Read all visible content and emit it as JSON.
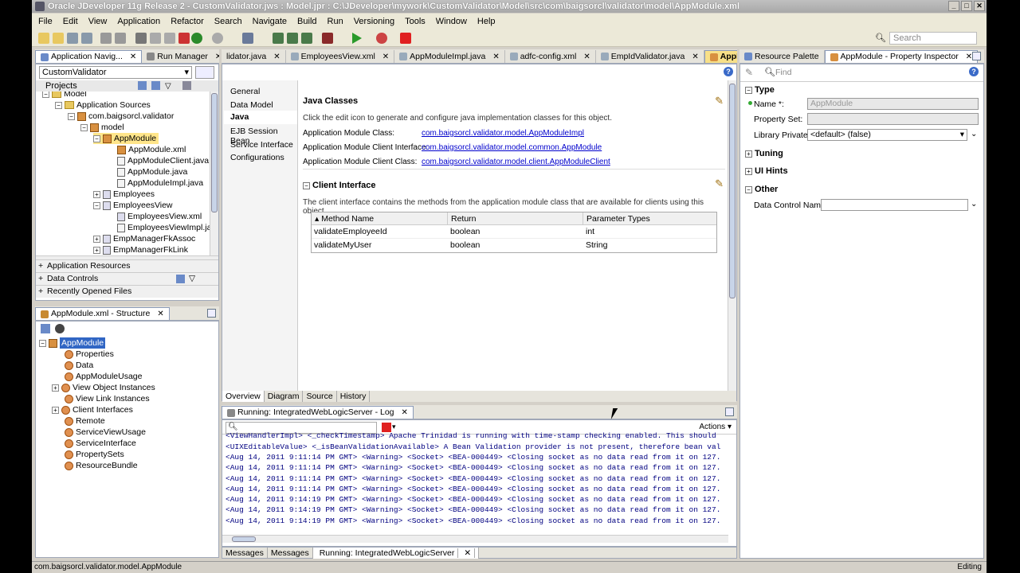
{
  "window": {
    "title": "Oracle JDeveloper 11g Release 2 - CustomValidator.jws : Model.jpr : C:\\JDeveloper\\mywork\\CustomValidator\\Model\\src\\com\\baigsorcl\\validator\\model\\AppModule.xml"
  },
  "menu": [
    "File",
    "Edit",
    "View",
    "Application",
    "Refactor",
    "Search",
    "Navigate",
    "Build",
    "Run",
    "Versioning",
    "Tools",
    "Window",
    "Help"
  ],
  "toolbar": {
    "search_placeholder": "Search"
  },
  "nav": {
    "tabs": [
      {
        "label": "Application Navig..."
      },
      {
        "label": "Run Manager"
      }
    ],
    "app_select": "CustomValidator",
    "projects_label": "Projects",
    "tree": [
      {
        "label": "Model"
      },
      {
        "label": "Application Sources"
      },
      {
        "label": "com.baigsorcl.validator"
      },
      {
        "label": "model"
      },
      {
        "label": "AppModule"
      },
      {
        "label": "AppModule.xml"
      },
      {
        "label": "AppModuleClient.java"
      },
      {
        "label": "AppModule.java"
      },
      {
        "label": "AppModuleImpl.java"
      },
      {
        "label": "Employees"
      },
      {
        "label": "EmployeesView"
      },
      {
        "label": "EmployeesView.xml"
      },
      {
        "label": "EmployeesViewImpl.java"
      },
      {
        "label": "EmpManagerFkAssoc"
      },
      {
        "label": "EmpManagerFkLink"
      }
    ],
    "accordion": [
      "Application Resources",
      "Data Controls",
      "Recently Opened Files"
    ]
  },
  "structure": {
    "tab": "AppModule.xml - Structure",
    "root": "AppModule",
    "items": [
      "Properties",
      "Data",
      "AppModuleUsage",
      "View Object Instances",
      "View Link Instances",
      "Client Interfaces",
      "Remote",
      "ServiceViewUsage",
      "ServiceInterface",
      "PropertySets",
      "ResourceBundle"
    ]
  },
  "editor": {
    "tabs": [
      {
        "label": "lidator.java"
      },
      {
        "label": "EmployeesView.xml"
      },
      {
        "label": "AppModuleImpl.java"
      },
      {
        "label": "adfc-config.xml"
      },
      {
        "label": "EmpIdValidator.java"
      },
      {
        "label": "AppModule.xml"
      }
    ],
    "sidenav": [
      "General",
      "Data Model",
      "Java",
      "EJB Session Bean",
      "Service Interface",
      "Configurations"
    ],
    "section_title": "Java Classes",
    "section_desc": "Click the edit icon to generate and configure java implementation classes for this object.",
    "rows": [
      {
        "label": "Application Module Class:",
        "value": "com.baigsorcl.validator.model.AppModuleImpl"
      },
      {
        "label": "Application Module Client Interface:",
        "value": "com.baigsorcl.validator.model.common.AppModule"
      },
      {
        "label": "Application Module Client Class:",
        "value": "com.baigsorcl.validator.model.client.AppModuleClient"
      }
    ],
    "client_title": "Client Interface",
    "client_desc": "The client interface contains the methods from the application module class that are available for clients using this object.",
    "table_headers": [
      "Method Name",
      "Return",
      "Parameter Types"
    ],
    "table_rows": [
      [
        "validateEmployeeId",
        "boolean",
        "int"
      ],
      [
        "validateMyUser",
        "boolean",
        "String"
      ]
    ],
    "bottom_tabs": [
      "Overview",
      "Diagram",
      "Source",
      "History"
    ]
  },
  "log": {
    "tab": "Running: IntegratedWebLogicServer - Log",
    "actions": "Actions",
    "lines": [
      "<ViewHandlerImpl> <_checkTimestamp> Apache Trinidad is running with time-stamp checking enabled. This should",
      "<UIXEditableValue> <_isBeanValidationAvailable> A Bean Validation provider is not present, therefore bean val",
      "<Aug 14, 2011 9:11:14 PM GMT> <Warning> <Socket> <BEA-000449> <Closing socket as no data read from it on 127.",
      "<Aug 14, 2011 9:11:14 PM GMT> <Warning> <Socket> <BEA-000449> <Closing socket as no data read from it on 127.",
      "<Aug 14, 2011 9:11:14 PM GMT> <Warning> <Socket> <BEA-000449> <Closing socket as no data read from it on 127.",
      "<Aug 14, 2011 9:11:14 PM GMT> <Warning> <Socket> <BEA-000449> <Closing socket as no data read from it on 127.",
      "<Aug 14, 2011 9:14:19 PM GMT> <Warning> <Socket> <BEA-000449> <Closing socket as no data read from it on 127.",
      "<Aug 14, 2011 9:14:19 PM GMT> <Warning> <Socket> <BEA-000449> <Closing socket as no data read from it on 127.",
      "<Aug 14, 2011 9:14:19 PM GMT> <Warning> <Socket> <BEA-000449> <Closing socket as no data read from it on 127."
    ],
    "bottom_tabs": [
      "Messages",
      "Messages",
      "Running: IntegratedWebLogicServer"
    ]
  },
  "inspector": {
    "tabs": [
      {
        "label": "Resource Palette"
      },
      {
        "label": "AppModule - Property Inspector"
      }
    ],
    "find_placeholder": "Find",
    "sections": {
      "type": "Type",
      "tuning": "Tuning",
      "ui_hints": "UI Hints",
      "other": "Other"
    },
    "name_label": "Name *:",
    "name_value": "AppModule",
    "property_set_label": "Property Set:",
    "library_private_label": "Library Private:",
    "library_private_value": "<default> (false)",
    "data_control_label": "Data Control Name:"
  },
  "status": {
    "left": "com.baigsorcl.validator.model.AppModule",
    "right": "Editing"
  }
}
